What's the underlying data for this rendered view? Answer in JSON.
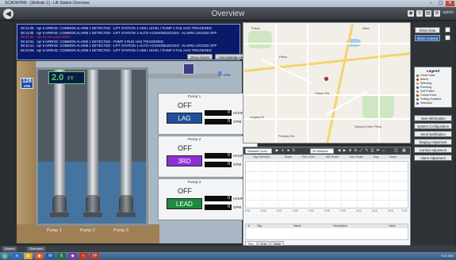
{
  "window": {
    "title": "SCADA/HMI - [Wellsite 1] - Lift Station Overview",
    "controls": [
      "–",
      "▢",
      "✕"
    ]
  },
  "header": {
    "title": "Overview",
    "back": "◀",
    "user": "admin",
    "icons": [
      "◉",
      "≡",
      "▤",
      "⚙"
    ]
  },
  "alarms": {
    "rows": [
      {
        "date": "Apr 6",
        "time": "09:11:09",
        "text": "ARRIVE: COMMON ALARM 1 DETECTED - LIFT STATION 1 HIGH LEVEL / PUMP 1 FAIL HAS TRIGGERED",
        "color": "white"
      },
      {
        "date": "Apr 6",
        "time": "09:11:09",
        "text": "ARRIVE: COMMON ALARM 1 DETECTED - LIFT STATION 1 AUTO-ACKNOWLEDGED - ALARM LOGGED OFF",
        "color": "white"
      },
      {
        "date": "Apr 6",
        "time": "09:11:06",
        "text": "Low Level Alarm",
        "color": "red"
      },
      {
        "date": "Apr 6",
        "time": "09:10:51",
        "text": "ARRIVE: COMMON ALARM 1 DETECTED - PUMP 2 RUN HAS TRIGGERED",
        "color": "white"
      },
      {
        "date": "Apr 6",
        "time": "09:10:14",
        "text": "ARRIVE: COMMON ALARM 1 DETECTED - LIFT STATION 1 AUTO-ACKNOWLEDGED - ALARM LOGGED OFF",
        "color": "white"
      },
      {
        "date": "Apr 6",
        "time": "09:10:08",
        "text": "ARRIVE: COMMON ALARM 1 DETECTED - LIFT STATION 2 HIGH LEVEL / PUMP 3 FAIL HAS TRIGGERED",
        "color": "white"
      }
    ],
    "btn_show": "Show Alarms",
    "btn_ack": "Acknowledge All"
  },
  "scene": {
    "level_value": "2.0",
    "level_unit": "FT",
    "inflow_value": "128",
    "inflow_unit": "GPM",
    "discharge_value": "0",
    "discharge_unit": "GPM",
    "pump_labels": [
      "Pump 1",
      "Pump 2",
      "Pump 3"
    ]
  },
  "pumps": [
    {
      "name": "Pump 1",
      "state": "OFF",
      "mode": "LAG",
      "hours": "0",
      "hours_unit": "HOURS",
      "flow": "0",
      "flow_unit": "GPM",
      "color": "#1f4f9c",
      "text_color": "#ffffff"
    },
    {
      "name": "Pump 2",
      "state": "OFF",
      "mode": "3RD",
      "hours": "0",
      "hours_unit": "HOURS",
      "flow": "0",
      "flow_unit": "GPM",
      "color": "#8f2fd8",
      "text_color": "#ffffff"
    },
    {
      "name": "Pump 3",
      "state": "OFF",
      "mode": "LEAD",
      "hours": "0",
      "hours_unit": "HOURS",
      "flow": "0",
      "flow_unit": "GPM",
      "color": "#1e8a3c",
      "text_color": "#ffffff"
    }
  ],
  "right_panel": {
    "show_data": "Show Data",
    "show_camera": "Show Camera",
    "legend_title": "Legend",
    "legend_items": [
      {
        "label": "Good Data",
        "color": "#2f8a2f"
      },
      {
        "label": "Alarm",
        "color": "#d22020"
      },
      {
        "label": "Warning",
        "color": "#e0a020"
      },
      {
        "label": "Running",
        "color": "#2f5ea8"
      },
      {
        "label": "Not Polled",
        "color": "#888888"
      },
      {
        "label": "Comm Error",
        "color": "#d22020"
      },
      {
        "label": "Polling Enabled",
        "color": "#2f8a2f"
      },
      {
        "label": "Selected",
        "color": "#8f2fd8"
      }
    ],
    "nav": [
      "View Information",
      "System Configuration",
      "Send Notification",
      "Staging Adjusment",
      "Control Adjusment",
      "Alarm Adjusment"
    ]
  },
  "trend": {
    "select_value": "Wetwell Level",
    "select2_value": "30 Minutes",
    "tool_icons": [
      "▶",
      "⏸",
      "⏹",
      "↻",
      "◀",
      "▶",
      "⊕",
      "⊖",
      "⤢",
      "✎",
      "⎙",
      "⇄",
      "⌂",
      "◫",
      "▦"
    ],
    "header_cols": [
      "Tag Selected",
      "Scale",
      "Pen Color",
      "Min Scale",
      "Max Scale",
      "Avg",
      "Value"
    ],
    "time_ticks": [
      "8:51",
      "8:54",
      "8:57",
      "9:00",
      "9:03",
      "9:06",
      "9:09",
      "9:12",
      "9:15",
      "9:18",
      "9:21"
    ],
    "grid_cols": [
      "#",
      "Tag",
      "Name",
      "Description",
      "Value"
    ],
    "tabs": [
      "Plot",
      "Grid",
      "Table"
    ]
  },
  "footer": {
    "tabs": [
      "Alarms",
      "Overview"
    ]
  },
  "taskbar": {
    "apps": [
      {
        "icon": "e",
        "color": "#2d6fbf"
      },
      {
        "icon": "▤",
        "color": "#d9a42a"
      },
      {
        "icon": "◉",
        "color": "#e0562c"
      },
      {
        "icon": "W",
        "color": "#2b579a"
      },
      {
        "icon": "X",
        "color": "#217346"
      },
      {
        "icon": "◆",
        "color": "#7b3fa0"
      },
      {
        "icon": "◐",
        "color": "#c23b22"
      },
      {
        "icon": "YF",
        "color": "#c0392b"
      }
    ],
    "clock": "9:21 AM"
  },
  "map": {
    "labels": [
      "Plano",
      "Frisco",
      "Allen",
      "Parker Rd",
      "Legacy Dr",
      "Spring Creek Pkwy",
      "Preston Rd"
    ]
  }
}
